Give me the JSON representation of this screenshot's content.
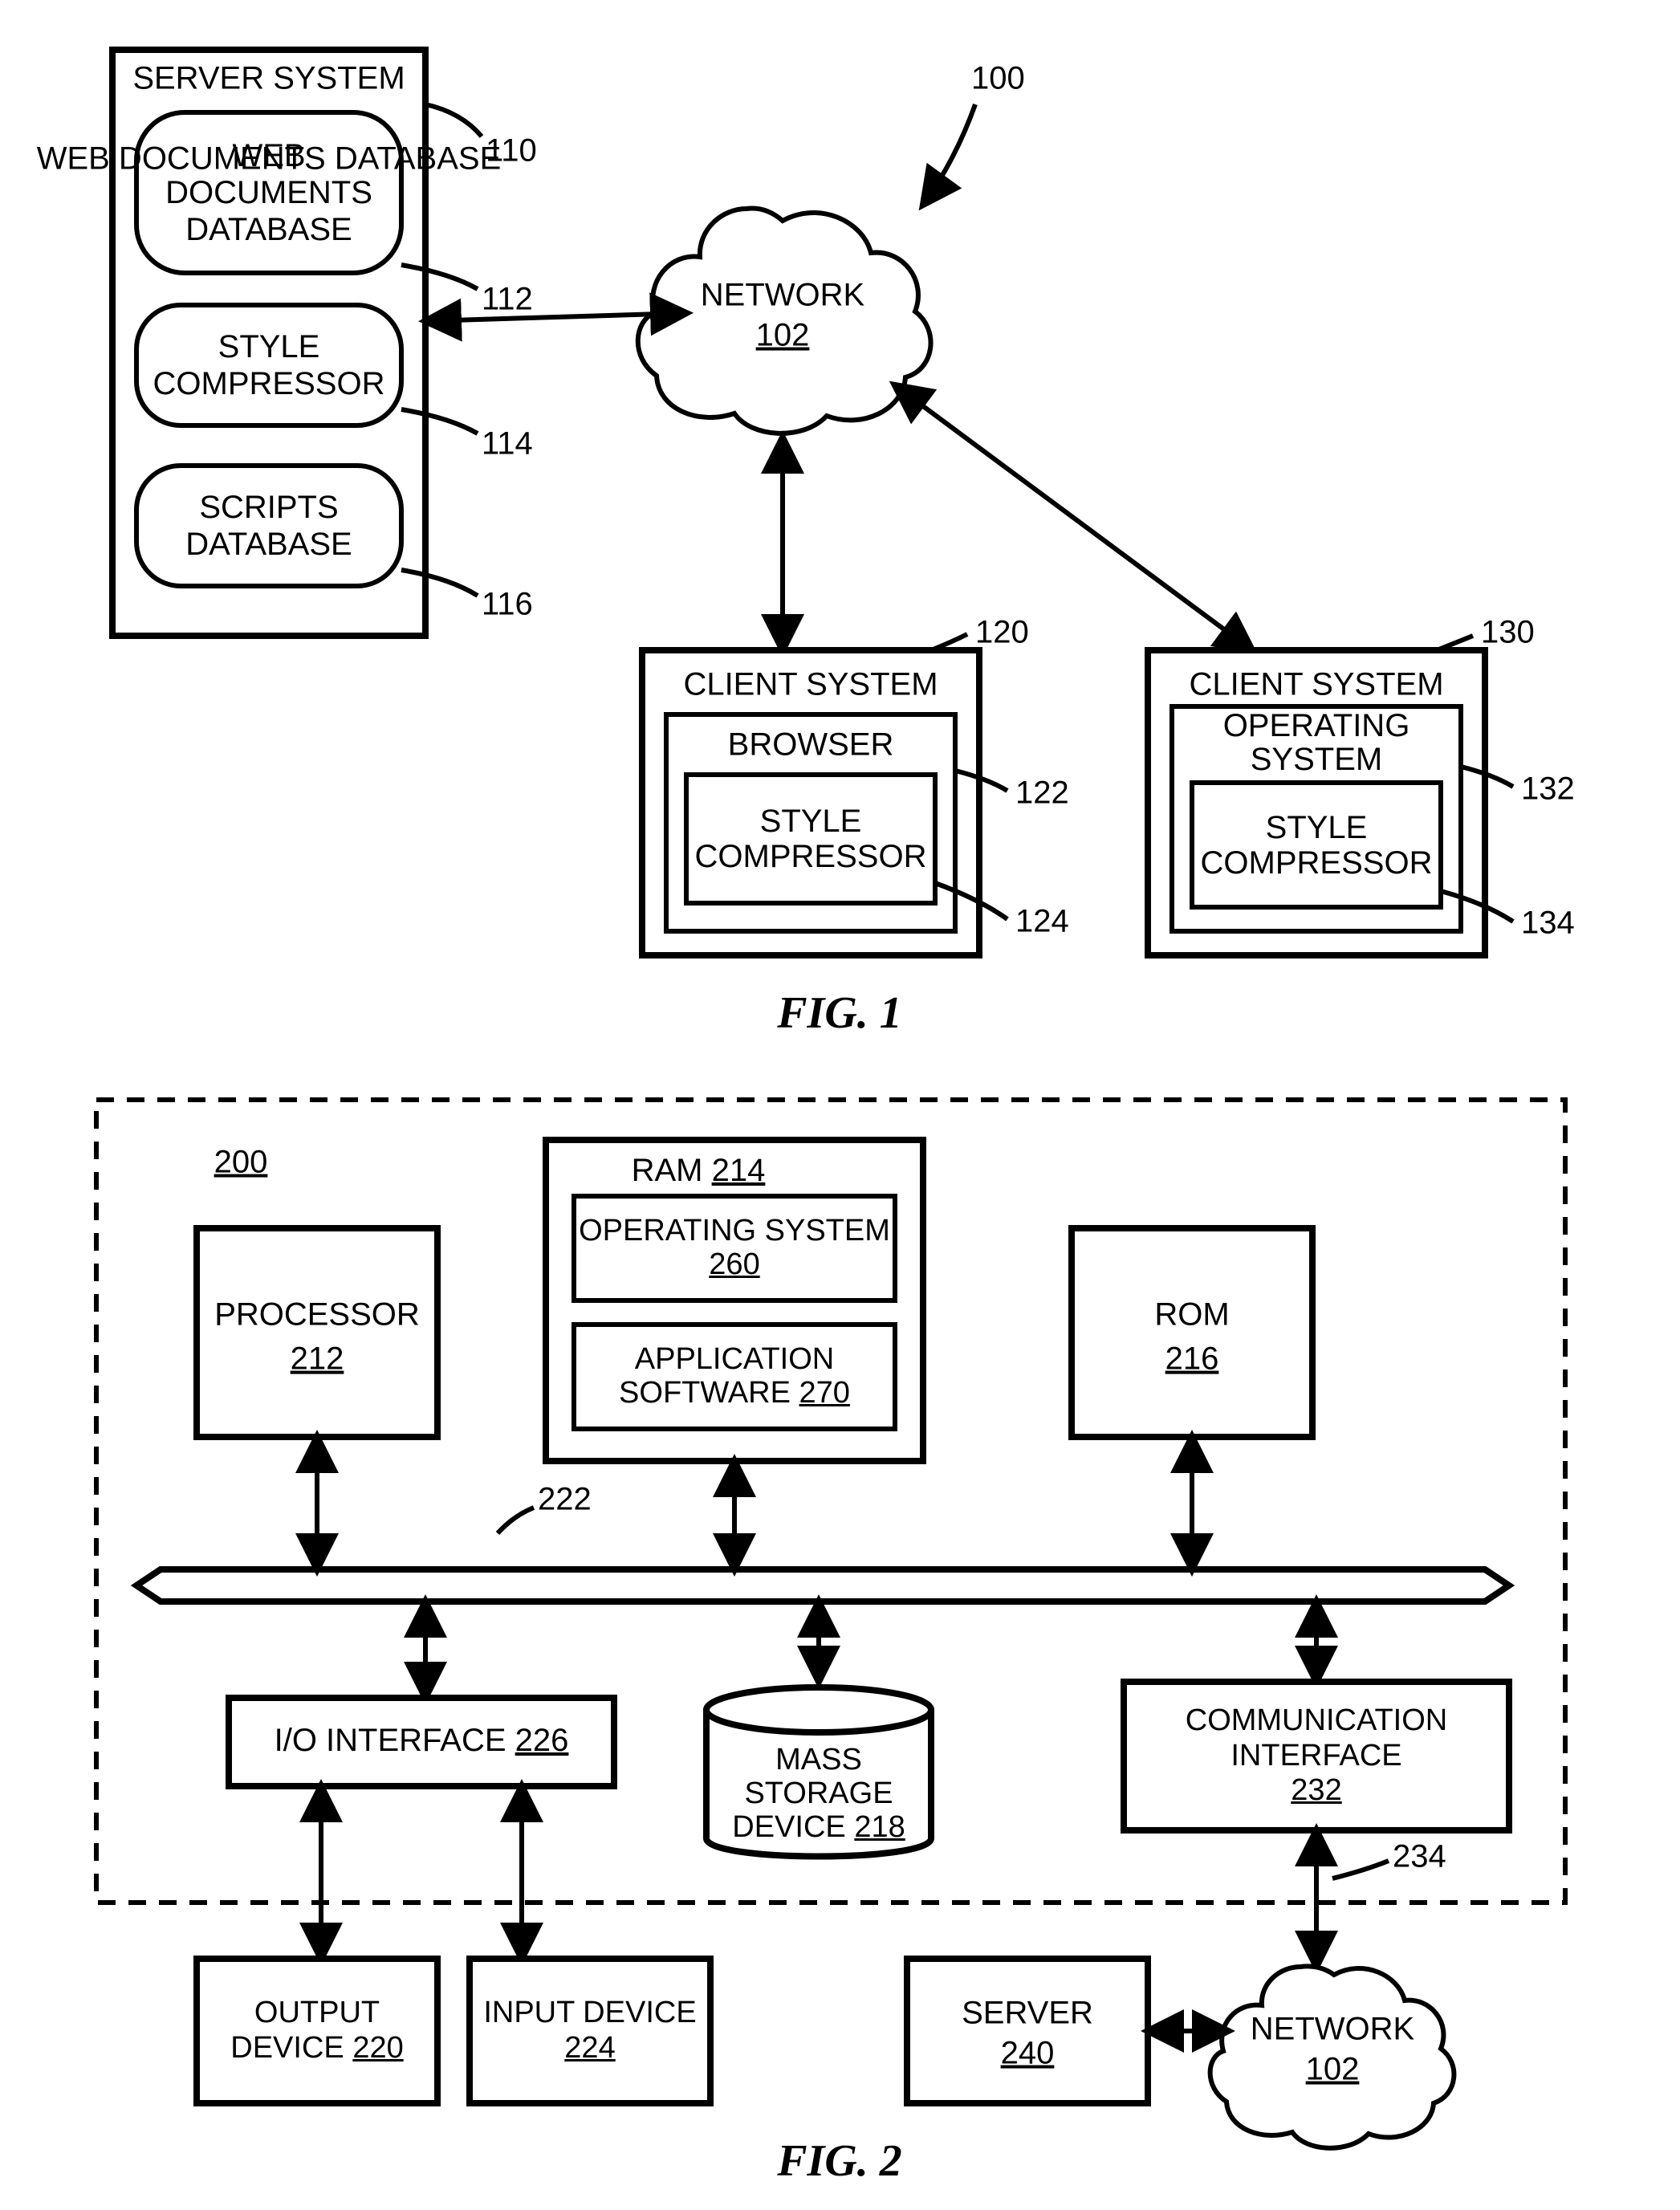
{
  "fig1": {
    "caption": "FIG. 1",
    "overall_ref": "100",
    "server_system": {
      "title": "SERVER SYSTEM",
      "ref": "110",
      "web_docs": {
        "label": "WEB DOCUMENTS DATABASE",
        "ref": "112"
      },
      "style_compressor": {
        "label": "STYLE COMPRESSOR",
        "ref": "114"
      },
      "scripts_db": {
        "label": "SCRIPTS DATABASE",
        "ref": "116"
      }
    },
    "network": {
      "label": "NETWORK",
      "ref": "102"
    },
    "client_a": {
      "title": "CLIENT SYSTEM",
      "ref": "120",
      "browser": {
        "label": "BROWSER",
        "ref": "122"
      },
      "style_compressor": {
        "label": "STYLE COMPRESSOR",
        "ref": "124"
      }
    },
    "client_b": {
      "title": "CLIENT SYSTEM",
      "ref": "130",
      "os": {
        "label": "OPERATING SYSTEM",
        "ref": "132"
      },
      "style_compressor": {
        "label": "STYLE COMPRESSOR",
        "ref": "134"
      }
    }
  },
  "fig2": {
    "caption": "FIG. 2",
    "system_ref": "200",
    "processor": {
      "label": "PROCESSOR",
      "ref": "212"
    },
    "ram": {
      "label": "RAM",
      "ref": "214",
      "os": {
        "label": "OPERATING SYSTEM",
        "ref": "260"
      },
      "app": {
        "label": "APPLICATION SOFTWARE",
        "ref": "270"
      }
    },
    "rom": {
      "label": "ROM",
      "ref": "216"
    },
    "bus_ref": "222",
    "io_interface": {
      "label": "I/O INTERFACE",
      "ref": "226"
    },
    "mass_storage": {
      "label": "MASS STORAGE DEVICE",
      "ref": "218"
    },
    "comm_interface": {
      "label": "COMMUNICATION INTERFACE",
      "ref": "232"
    },
    "comm_link_ref": "234",
    "output_device": {
      "label": "OUTPUT DEVICE",
      "ref": "220"
    },
    "input_device": {
      "label": "INPUT DEVICE",
      "ref": "224"
    },
    "server": {
      "label": "SERVER",
      "ref": "240"
    },
    "network": {
      "label": "NETWORK",
      "ref": "102"
    }
  }
}
